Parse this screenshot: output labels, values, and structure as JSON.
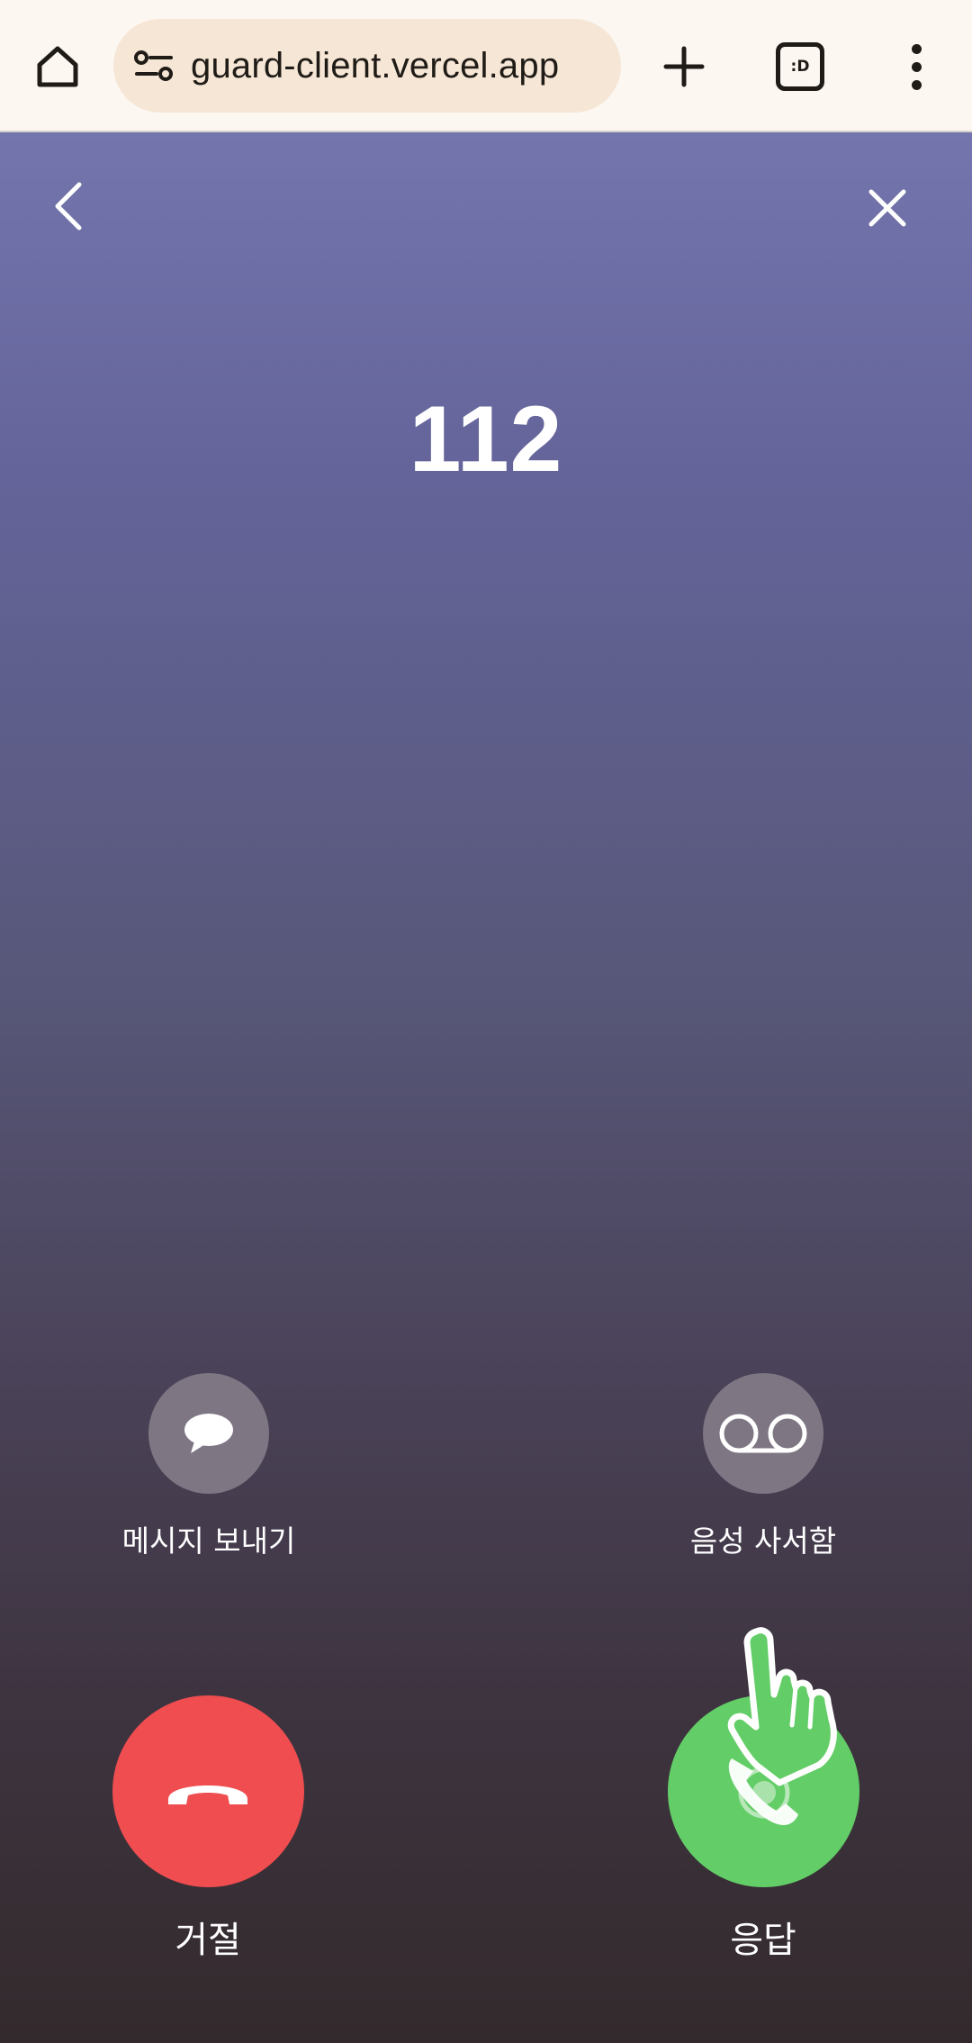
{
  "browser": {
    "url": "guard-client.vercel.app",
    "tab_badge": ":D",
    "icons": {
      "home": "home-icon",
      "site_settings": "tune-icon",
      "new_tab": "plus-icon",
      "tabs": "tab-switcher-icon",
      "menu": "more-vert-icon"
    }
  },
  "call": {
    "caller_number": "112",
    "message_label": "메시지 보내기",
    "voicemail_label": "음성 사서함",
    "decline_label": "거절",
    "answer_label": "응답",
    "icons": {
      "back": "chevron-left-icon",
      "close": "close-icon",
      "message": "chat-bubble-icon",
      "voicemail": "voicemail-icon",
      "decline": "phone-hangup-icon",
      "answer": "phone-icon",
      "tap_hint": "tap-hand-icon"
    },
    "colors": {
      "decline": "#ef4d50",
      "answer": "#63cd67",
      "small_button": "#7f7684",
      "gradient_top": "#7475ad",
      "gradient_bottom": "#332a2d"
    }
  }
}
